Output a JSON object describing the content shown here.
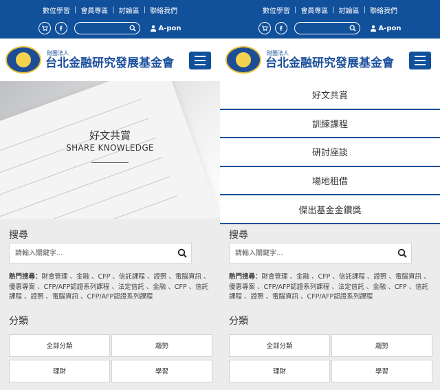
{
  "toplinks": [
    "數位學習",
    "會員專區",
    "討論區",
    "聯絡我們"
  ],
  "user": {
    "name": "A-pon"
  },
  "logo": {
    "small": "財團法人",
    "big": "台北金融研究發展基金會",
    "seal": "基金會"
  },
  "hero": {
    "title": "好文共賞",
    "subtitle": "SHARE KNOWLEDGE"
  },
  "menu": [
    "好文共賞",
    "訓練課程",
    "研討座談",
    "場地租借",
    "傑出基金金鑽獎"
  ],
  "search": {
    "title": "搜尋",
    "placeholder": "請輸入關鍵字...",
    "hot_label": "熱門搜尋：",
    "hot_text": "財會管理 、金融 、CFP 、信託課程 、證照 、電腦資訊 、優惠專案 、CFP/AFP認證系列課程 、法定信託 、金融 、CFP 、信託課程 、證照 、電腦資訊 、CFP/AFP認證系列課程"
  },
  "categories": {
    "title": "分類",
    "items": [
      "全部分類",
      "趨勢",
      "理財",
      "學習"
    ]
  },
  "colors": {
    "brand": "#11509b",
    "gold": "#e8c13a"
  },
  "icons": [
    "cart-icon",
    "facebook-icon",
    "search-icon",
    "user-icon",
    "menu-icon"
  ]
}
